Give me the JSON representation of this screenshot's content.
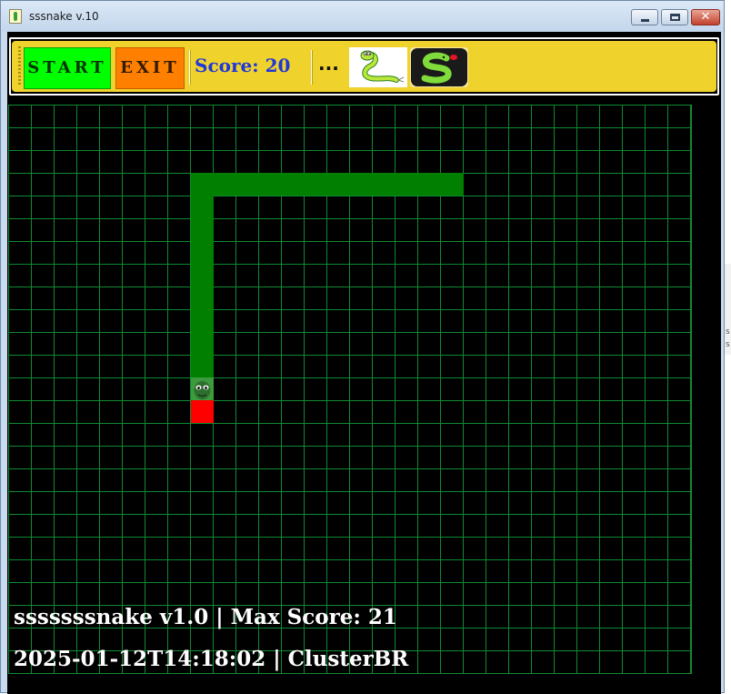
{
  "window": {
    "title": "sssnake v.10",
    "controls": {
      "minimize": "minimize",
      "maximize": "maximize",
      "close": "✕"
    }
  },
  "toolbar": {
    "start_label": "START",
    "exit_label": "EXIT",
    "score_label": "Score: 20",
    "more_label": "...",
    "thumbnails": [
      "snake-cartoon-image",
      "snake-logo-image"
    ]
  },
  "game": {
    "grid_color": "#0e8a32",
    "snake_color": "#007f00",
    "food_color": "#ff0000"
  },
  "overlay": {
    "line1": "sssssssnake v1.0 | Max Score: 21",
    "line2": "2025-01-12T14:18:02 | ClusterBR"
  },
  "background_window_fragment": {
    "lines": [
      "s",
      "s"
    ]
  }
}
